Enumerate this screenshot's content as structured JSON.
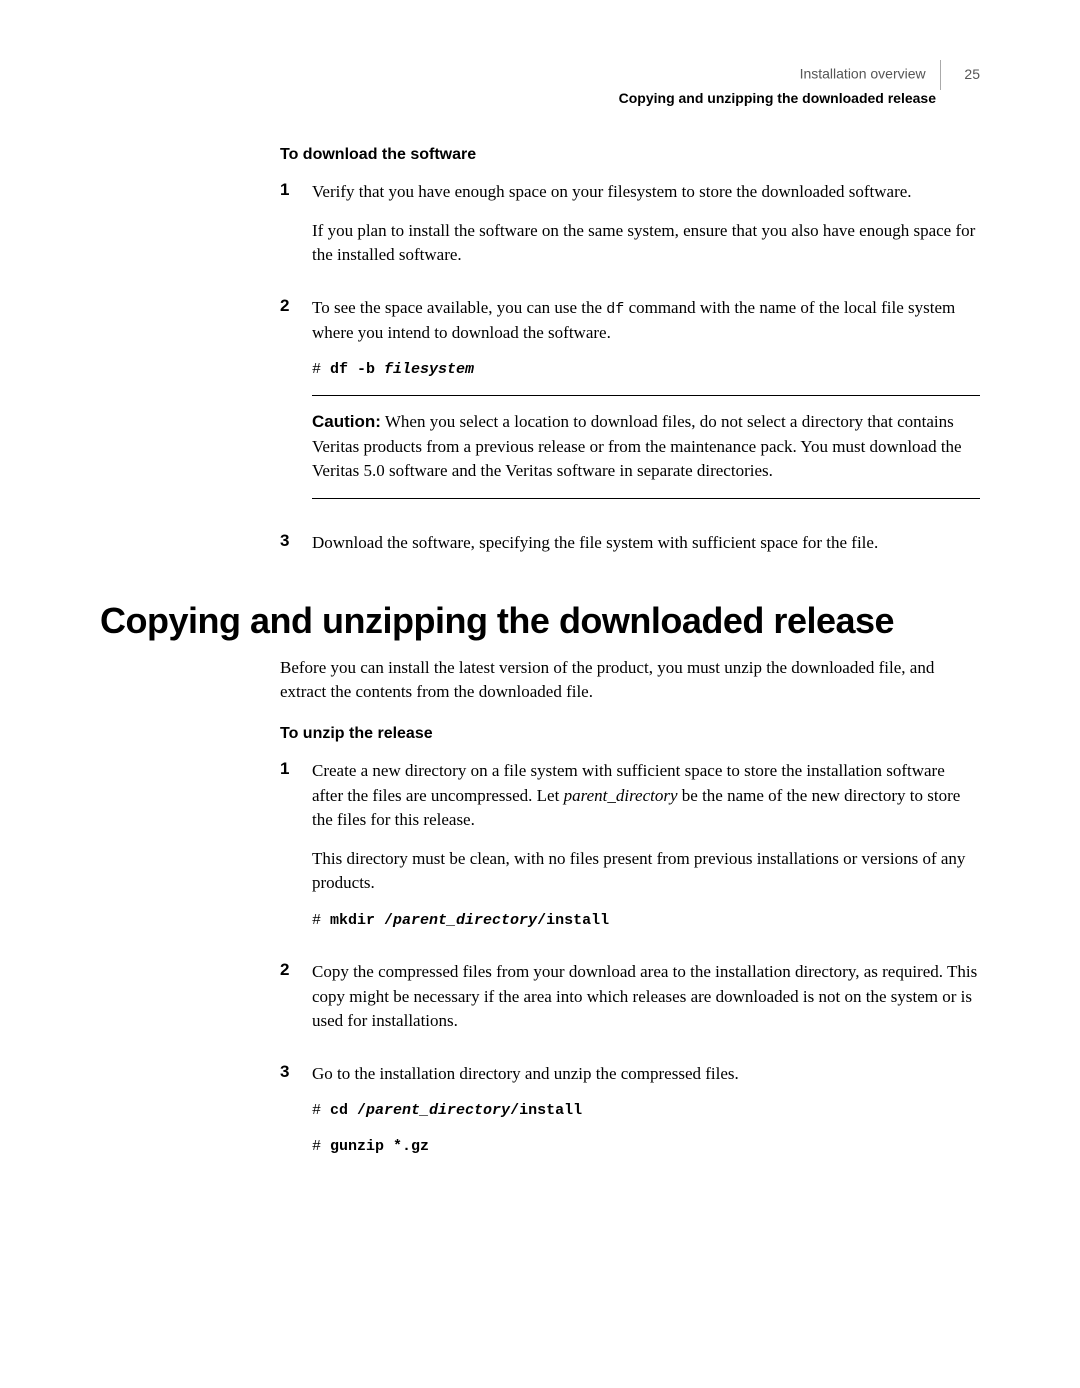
{
  "header": {
    "chapter": "Installation overview",
    "section": "Copying and unzipping the downloaded release",
    "page_number": "25"
  },
  "sub1_title": "To download the software",
  "step1": {
    "num": "1",
    "p1": "Verify that you have enough space on your filesystem to store the downloaded software.",
    "p2": "If you plan to install the software on the same system, ensure that you also have enough space for the installed software."
  },
  "step2": {
    "num": "2",
    "p1_a": "To see the space available, you can use the ",
    "p1_code": "df",
    "p1_b": " command with the name of the local file system where you intend to download the software.",
    "code_prompt": "# ",
    "code_cmd": "df -b ",
    "code_arg": "filesystem",
    "caution_label": "Caution:",
    "caution_text": " When you select a location to download files, do not select a directory that contains Veritas products from a previous release or from the maintenance pack. You must download the Veritas 5.0 software and the Veritas software in separate directories."
  },
  "step3": {
    "num": "3",
    "p1": "Download the software, specifying the file system with sufficient space for the file."
  },
  "h1": "Copying and unzipping the downloaded release",
  "intro": "Before you can install the latest version of the product, you must unzip the downloaded file, and extract the contents from the downloaded file.",
  "sub2_title": "To unzip the release",
  "ustep1": {
    "num": "1",
    "p1_a": "Create a new directory on a file system with sufficient space to store the installation software after the files are uncompressed. Let ",
    "p1_italic": "parent_directory",
    "p1_b": " be the name of the new directory to store the files for this release.",
    "p2": "This directory must be clean, with no files present from previous installations or versions of any products.",
    "code_prompt": "# ",
    "code_cmd_a": "mkdir /",
    "code_arg": "parent_directory",
    "code_cmd_b": "/install"
  },
  "ustep2": {
    "num": "2",
    "p1": "Copy the compressed files from your download area to the installation directory, as required. This copy might be necessary if the area into which releases are downloaded is not on the system or is used for installations."
  },
  "ustep3": {
    "num": "3",
    "p1": "Go to the installation directory and unzip the compressed files.",
    "code1_prompt": "# ",
    "code1_cmd_a": "cd /",
    "code1_arg": "parent_directory",
    "code1_cmd_b": "/install",
    "code2_prompt": "# ",
    "code2_cmd": "gunzip *.gz"
  }
}
